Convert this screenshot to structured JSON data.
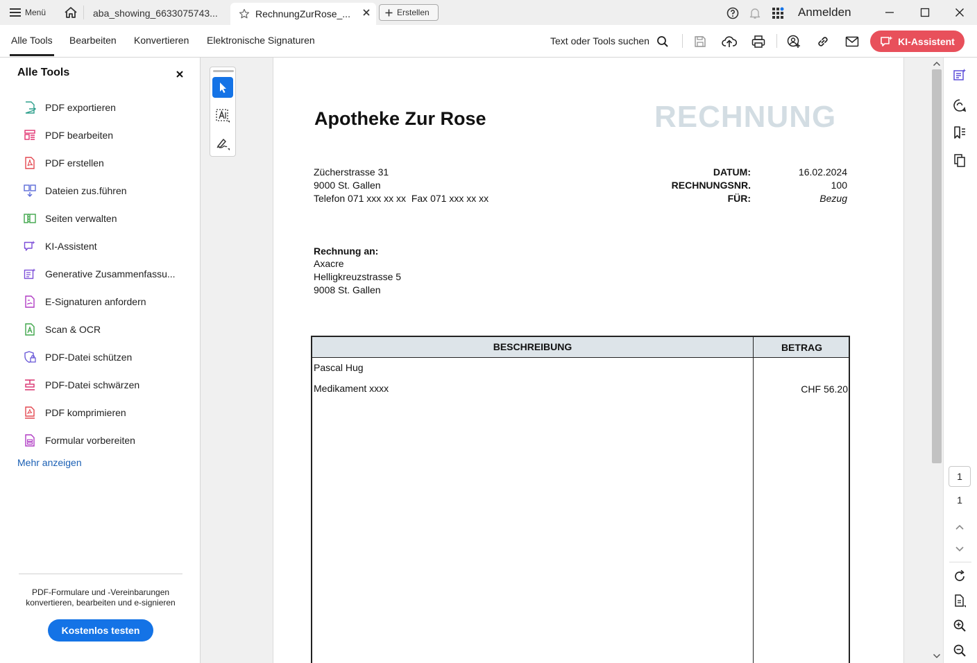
{
  "titlebar": {
    "menu_label": "Menü",
    "tabs": [
      {
        "label": "aba_showing_6633075743..."
      },
      {
        "label": "RechnungZurRose_..."
      }
    ],
    "new_button": "Erstellen",
    "signin": "Anmelden"
  },
  "toolbar": {
    "tabs": [
      "Alle Tools",
      "Bearbeiten",
      "Konvertieren",
      "Elektronische Signaturen"
    ],
    "search_label": "Text oder Tools suchen",
    "ai_button": "KI-Assistent",
    "accent": "#e8505b"
  },
  "left_panel": {
    "title": "Alle Tools",
    "items": [
      {
        "label": "PDF exportieren",
        "icon": "export-pdf-icon",
        "color": "#2d9f8c"
      },
      {
        "label": "PDF bearbeiten",
        "icon": "edit-pdf-icon",
        "color": "#e0306e"
      },
      {
        "label": "PDF erstellen",
        "icon": "create-pdf-icon",
        "color": "#e34850"
      },
      {
        "label": "Dateien zus.führen",
        "icon": "combine-files-icon",
        "color": "#5c6bd8"
      },
      {
        "label": "Seiten verwalten",
        "icon": "organize-pages-icon",
        "color": "#3ea64a"
      },
      {
        "label": "KI-Assistent",
        "icon": "ai-assistant-icon",
        "color": "#7c4dd8"
      },
      {
        "label": "Generative Zusammenfassu...",
        "icon": "generative-summary-icon",
        "color": "#7c4dd8"
      },
      {
        "label": "E-Signaturen anfordern",
        "icon": "request-esign-icon",
        "color": "#b03cc4"
      },
      {
        "label": "Scan & OCR",
        "icon": "scan-ocr-icon",
        "color": "#3ea64a"
      },
      {
        "label": "PDF-Datei schützen",
        "icon": "protect-pdf-icon",
        "color": "#6b5bd8"
      },
      {
        "label": "PDF-Datei schwärzen",
        "icon": "redact-pdf-icon",
        "color": "#d8306e"
      },
      {
        "label": "PDF komprimieren",
        "icon": "compress-pdf-icon",
        "color": "#e34850"
      },
      {
        "label": "Formular vorbereiten",
        "icon": "prepare-form-icon",
        "color": "#b03cc4"
      }
    ],
    "more_link": "Mehr anzeigen",
    "promo_text": "PDF-Formulare und -Vereinbarungen konvertieren, bearbeiten und e-signieren",
    "trial_button": "Kostenlos testen"
  },
  "document": {
    "company": "Apotheke Zur Rose",
    "doc_title": "RECHNUNG",
    "address": [
      "Zücherstrasse 31",
      "9000 St. Gallen",
      "Telefon 071 xxx xx xx  Fax 071 xxx xx xx"
    ],
    "meta": [
      {
        "label": "DATUM:",
        "value": "16.02.2024"
      },
      {
        "label": "RECHNUNGSNR.",
        "value": "100"
      },
      {
        "label": "FÜR:",
        "value": "Bezug"
      }
    ],
    "bill_to_label": "Rechnung an:",
    "bill_to": [
      "Axacre",
      "Helligkreuzstrasse 5",
      "9008 St. Gallen"
    ],
    "table": {
      "headers": [
        "BESCHREIBUNG",
        "BETRAG"
      ],
      "rows": [
        {
          "desc": "Pascal Hug",
          "amount": ""
        },
        {
          "desc": "Medikament xxxx",
          "amount": "CHF 56.20"
        }
      ]
    }
  },
  "page_nav": {
    "current": "1",
    "total": "1"
  }
}
